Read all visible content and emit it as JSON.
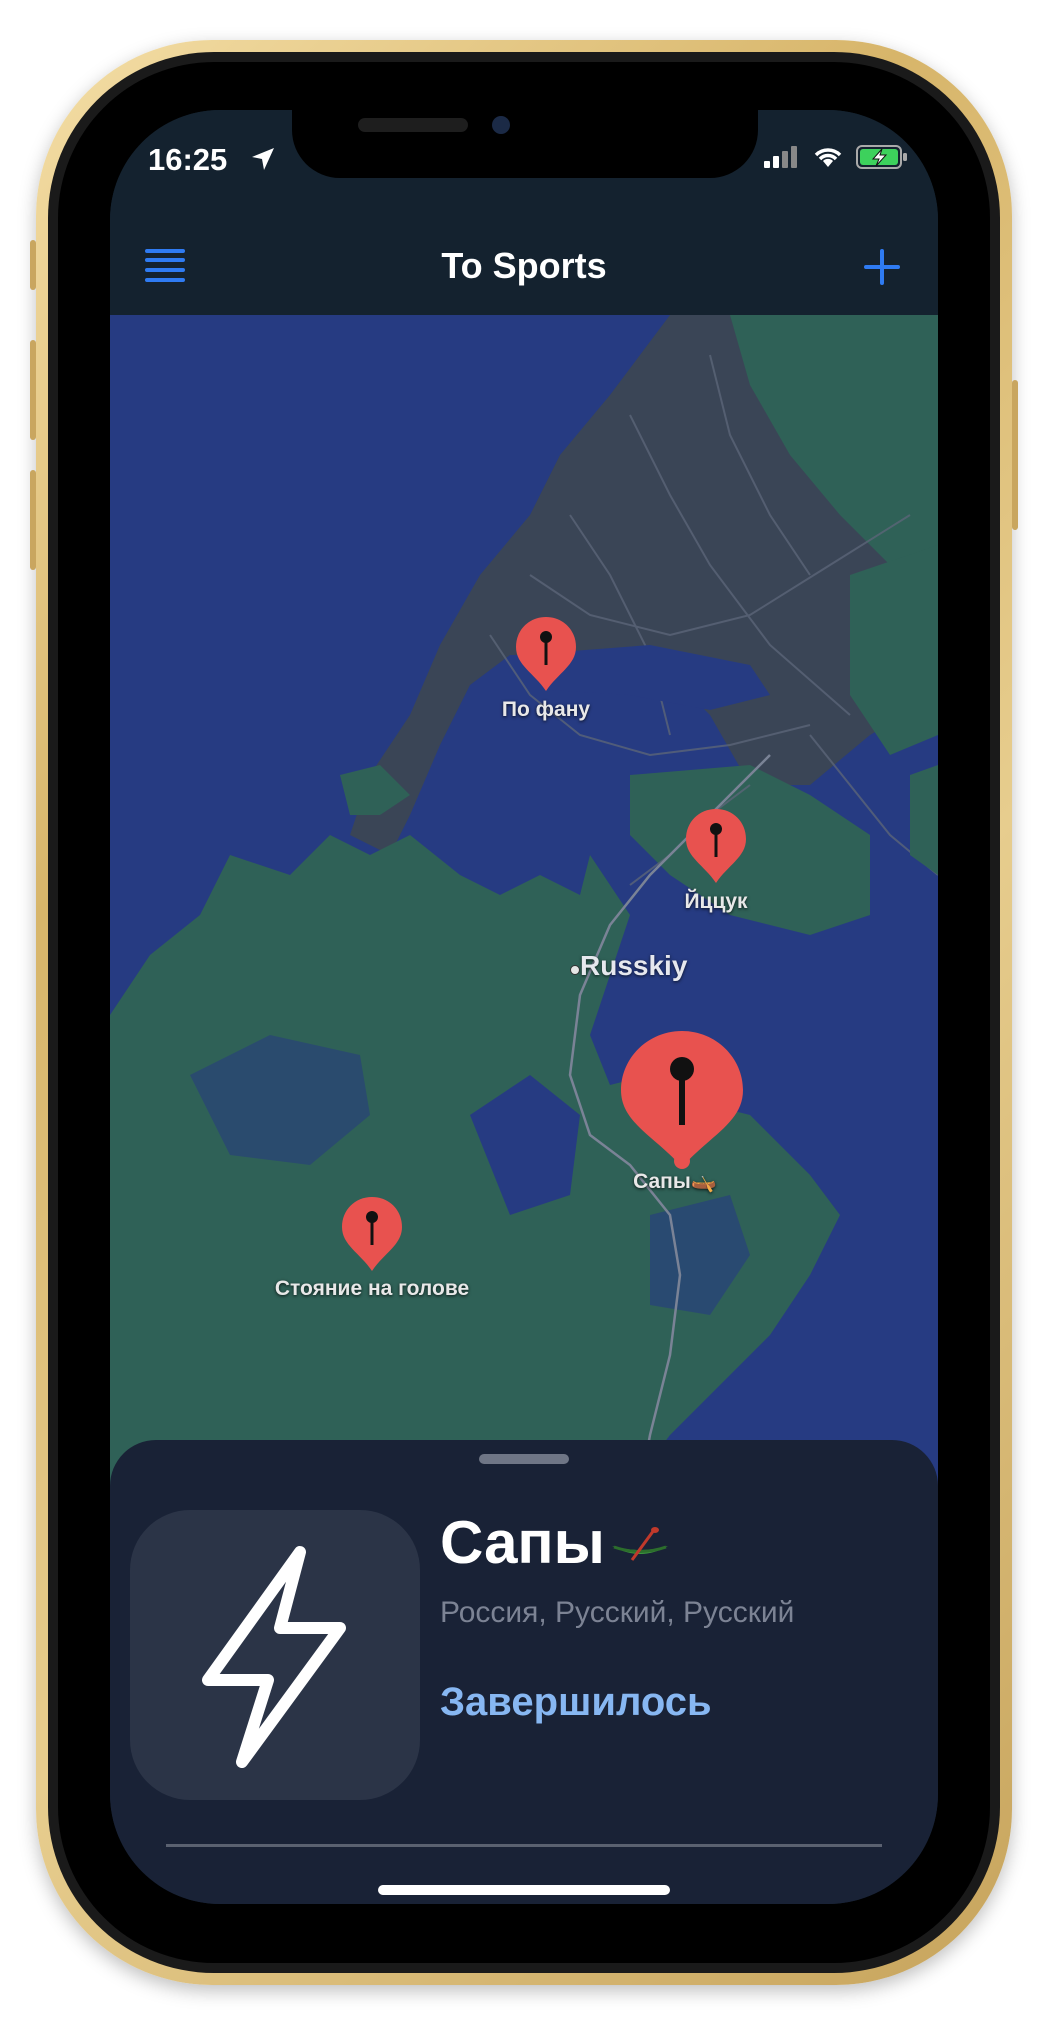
{
  "status_bar": {
    "time": "16:25",
    "icons": [
      "location-arrow-icon",
      "signal-icon",
      "wifi-icon",
      "battery-charging-icon"
    ]
  },
  "nav": {
    "title": "To Sports",
    "left_icon": "menu-icon",
    "right_icon": "plus-icon"
  },
  "map": {
    "city_label": "Russkiy",
    "pins": [
      {
        "label": "По фану"
      },
      {
        "label": "Йццук"
      },
      {
        "label": "Сапы🛶"
      },
      {
        "label": "Стояние на голове"
      }
    ]
  },
  "sheet": {
    "title": "Сапы",
    "title_emoji": "canoe-icon",
    "location": "Россия, Русский, Русский",
    "status": "Завершилось",
    "thumbnail_icon": "lightning-bolt-icon"
  },
  "colors": {
    "accent": "#2f7bf2",
    "pin": "#e8524f",
    "status_text": "#87b7f2",
    "water": "#263b82",
    "land": "#2f6157",
    "urban": "#3a4556"
  }
}
